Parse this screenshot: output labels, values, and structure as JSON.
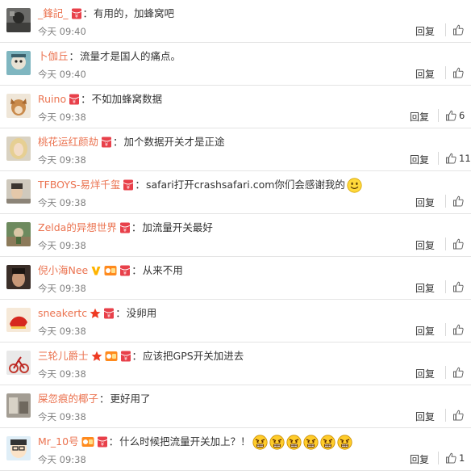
{
  "actions": {
    "reply_label": "回复"
  },
  "colors": {
    "username": "#eb7350",
    "badge_red": "#e8404a",
    "badge_orange": "#ff8a1d",
    "vip_gold": "#ffb400",
    "star": "#ee3a22"
  },
  "comments": [
    {
      "username": "_鋒記_",
      "separator": "：",
      "text": "有用的，加蜂窝吧",
      "time": "今天 09:40",
      "likes": "",
      "badges": [
        "red-packet-icon"
      ],
      "emoji_count": 0,
      "avatar": "avatar-dark"
    },
    {
      "username": "卜伽丘",
      "separator": "：",
      "text": "流量才是国人的痛点。",
      "time": "今天 09:40",
      "likes": "",
      "badges": [],
      "emoji_count": 0,
      "avatar": "avatar-teal"
    },
    {
      "username": "Ruino",
      "separator": "：",
      "text": "不如加蜂窝数据",
      "time": "今天 09:38",
      "likes": "6",
      "badges": [
        "red-packet-icon"
      ],
      "emoji_count": 0,
      "avatar": "avatar-dog"
    },
    {
      "username": "桃花运红颜劫",
      "separator": "：",
      "text": "加个数据开关才是正途",
      "time": "今天 09:38",
      "likes": "11",
      "badges": [
        "red-packet-icon"
      ],
      "emoji_count": 0,
      "avatar": "avatar-blonde"
    },
    {
      "username": "TFBOYS-易烊千玺",
      "separator": "：",
      "text": "safari打开crashsafari.com你们会感谢我的",
      "time": "今天 09:38",
      "likes": "",
      "badges": [
        "red-packet-icon"
      ],
      "emoji_count": 1,
      "emoji": "smile-emoji-icon",
      "avatar": "avatar-boy"
    },
    {
      "username": "Zelda的异想世界",
      "separator": "：",
      "text": "加流量开关最好",
      "time": "今天 09:38",
      "likes": "",
      "badges": [
        "red-packet-icon"
      ],
      "emoji_count": 0,
      "avatar": "avatar-forest"
    },
    {
      "username": "倪小海Nee",
      "separator": "：",
      "text": "从来不用",
      "time": "今天 09:38",
      "likes": "",
      "badges": [
        "vip-v-icon",
        "fan-badge-icon",
        "red-packet-icon"
      ],
      "emoji_count": 0,
      "avatar": "avatar-face"
    },
    {
      "username": "sneakertc",
      "separator": "：",
      "text": "没卵用",
      "time": "今天 09:38",
      "likes": "",
      "badges": [
        "star-icon",
        "red-packet-icon"
      ],
      "emoji_count": 0,
      "avatar": "avatar-red"
    },
    {
      "username": "三轮儿爵士",
      "separator": "：",
      "text": "应该把GPS开关加进去",
      "time": "今天 09:38",
      "likes": "",
      "badges": [
        "star-icon",
        "fan-badge-icon",
        "red-packet-icon"
      ],
      "emoji_count": 0,
      "avatar": "avatar-bike"
    },
    {
      "username": "屎忽痕的椰子",
      "separator": "：",
      "text": "更好用了",
      "time": "今天 09:38",
      "likes": "",
      "badges": [],
      "emoji_count": 0,
      "avatar": "avatar-room"
    },
    {
      "username": "Mr_10号",
      "separator": "：",
      "text": "什么时候把流量开关加上？！",
      "time": "今天 09:38",
      "likes": "1",
      "badges": [
        "fan-badge-icon",
        "red-packet-icon"
      ],
      "emoji_count": 6,
      "emoji": "angry-emoji-icon",
      "avatar": "avatar-cartoon"
    }
  ]
}
